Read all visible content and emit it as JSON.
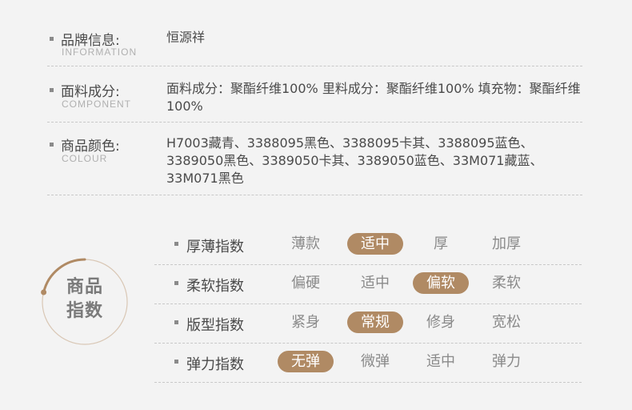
{
  "info": {
    "brand": {
      "label": "品牌信息:",
      "sublabel": "INFORMATION",
      "value": "恒源祥"
    },
    "component": {
      "label": "面料成分:",
      "sublabel": "COMPONENT",
      "value": "面料成分：聚酯纤维100% 里料成分：聚酯纤维100% 填充物：聚酯纤维100%"
    },
    "colour": {
      "label": "商品颜色:",
      "sublabel": "COLOUR",
      "value": "H7003藏青、3388095黑色、3388095卡其、3388095蓝色、3389050黑色、3389050卡其、3389050蓝色、33M071藏蓝、33M071黑色"
    }
  },
  "badge": {
    "line1": "商品",
    "line2": "指数",
    "accent_color": "#b08a64"
  },
  "indices": [
    {
      "name": "厚薄指数",
      "options": [
        "薄款",
        "适中",
        "厚",
        "加厚"
      ],
      "selected": 1
    },
    {
      "name": "柔软指数",
      "options": [
        "偏硬",
        "适中",
        "偏软",
        "柔软"
      ],
      "selected": 2
    },
    {
      "name": "版型指数",
      "options": [
        "紧身",
        "常规",
        "修身",
        "宽松"
      ],
      "selected": 1
    },
    {
      "name": "弹力指数",
      "options": [
        "无弹",
        "微弹",
        "适中",
        "弹力"
      ],
      "selected": 0
    }
  ]
}
